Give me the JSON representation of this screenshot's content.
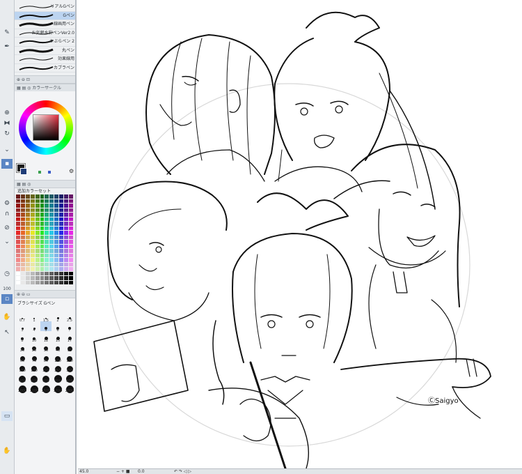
{
  "brushes": [
    {
      "label": "リアルGペン",
      "selected": false
    },
    {
      "label": "Gペン",
      "selected": true
    },
    {
      "label": "線画用ペン",
      "selected": false
    },
    {
      "label": "お気軽水彩ペンVer2.0",
      "selected": false
    },
    {
      "label": "かぶらペン 2",
      "selected": false
    },
    {
      "label": "丸ペン",
      "selected": false
    },
    {
      "label": "効果線用",
      "selected": false
    },
    {
      "label": "カブラペン",
      "selected": false
    }
  ],
  "color_panel": {
    "tab_label": "カラーサークル",
    "main_color": "#1a1a1a",
    "sub_color": "#1e3c78"
  },
  "palette": {
    "title": "追加カラーセット"
  },
  "brush_size": {
    "title": "ブラシサイズ Gペン",
    "selected": "5",
    "sizes": [
      "0.7",
      "1",
      "1.5",
      "2",
      "2.5",
      "3",
      "4",
      "5",
      "6",
      "7",
      "8",
      "10",
      "12",
      "15",
      "17",
      "20",
      "25",
      "30",
      "40",
      "50",
      "60",
      "70",
      "80",
      "100",
      "120",
      "150",
      "170",
      "200",
      "250",
      "300",
      "400",
      "500",
      "600",
      "700",
      "800",
      "1000",
      "1200",
      "1500",
      "1700",
      "2000"
    ]
  },
  "left_labels": {
    "zoom_fragment": "100",
    "icon_left_a": "C"
  },
  "status": {
    "zoom": "45.0",
    "rotate": "0.0"
  },
  "canvas": {
    "signature": "ⒸSaigyo"
  }
}
